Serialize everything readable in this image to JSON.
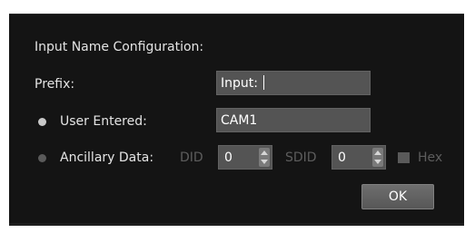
{
  "dialog": {
    "title": "Input Name Configuration:",
    "prefix_label": "Prefix:",
    "prefix_value": "Input: ",
    "options": {
      "user_entered": {
        "label": "User Entered:",
        "value": "CAM1",
        "selected": true
      },
      "ancillary_data": {
        "label": "Ancillary Data:",
        "selected": false
      }
    },
    "did_label": "DID",
    "did_value": "0",
    "sdid_label": "SDID",
    "sdid_value": "0",
    "hex_label": "Hex",
    "ok_label": "OK"
  },
  "colors": {
    "background": "#141414",
    "field": "#545454",
    "radio_selected": "#c9c9c9",
    "radio_unselected": "#5a5a5a",
    "disabled_text": "#5d5d5d"
  }
}
